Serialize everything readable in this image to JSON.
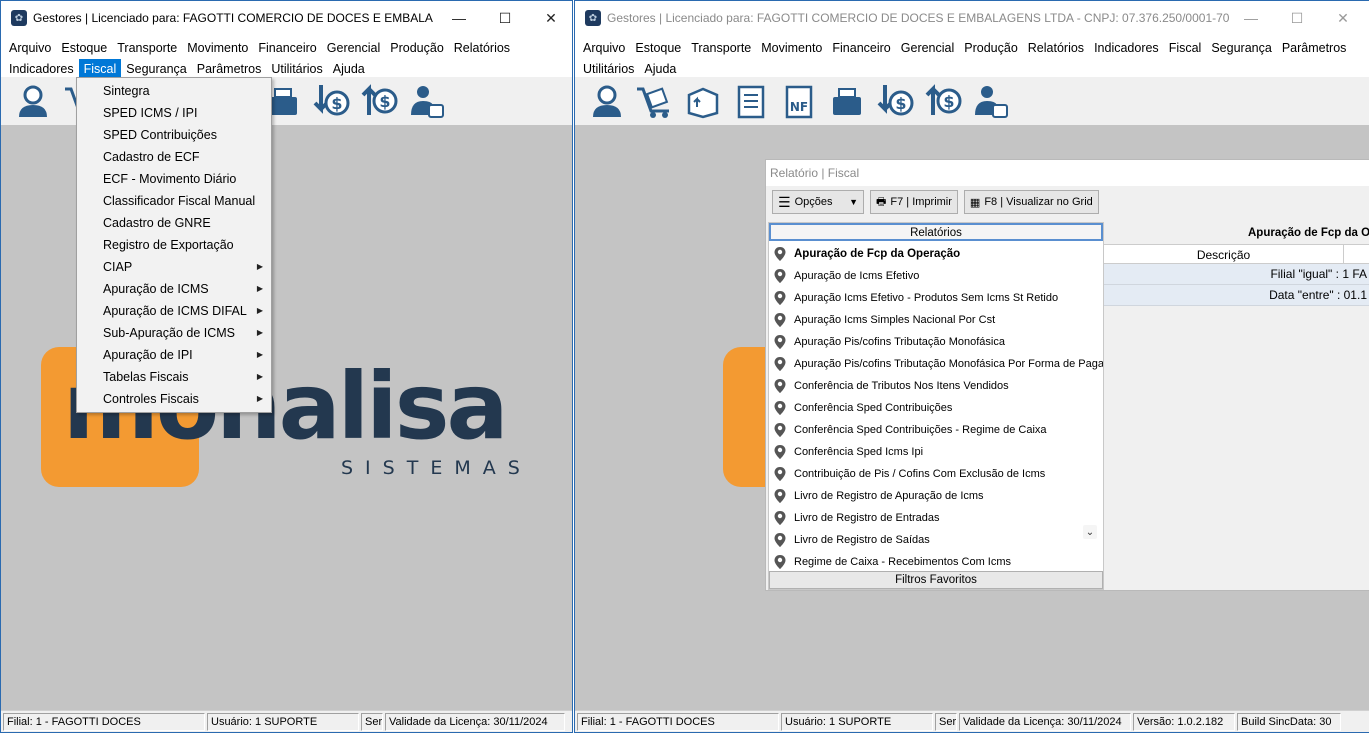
{
  "left_window": {
    "title": "Gestores | Licenciado para: FAGOTTI COMERCIO DE DOCES E EMBALAGEN...",
    "menu_row1": [
      "Arquivo",
      "Estoque",
      "Transporte",
      "Movimento",
      "Financeiro",
      "Gerencial",
      "Produção",
      "Relatórios"
    ],
    "menu_row2": [
      "Indicadores",
      "Fiscal",
      "Segurança",
      "Parâmetros",
      "Utilitários",
      "Ajuda"
    ],
    "active_menu": "Fiscal",
    "fiscal_menu": [
      {
        "label": "Sintegra",
        "submenu": false
      },
      {
        "label": "SPED ICMS / IPI",
        "submenu": false
      },
      {
        "label": "SPED Contribuições",
        "submenu": false
      },
      {
        "label": "Cadastro de ECF",
        "submenu": false
      },
      {
        "label": "ECF - Movimento Diário",
        "submenu": false
      },
      {
        "label": "Classificador Fiscal Manual",
        "submenu": false
      },
      {
        "label": "Cadastro de GNRE",
        "submenu": false
      },
      {
        "label": "Registro de Exportação",
        "submenu": false
      },
      {
        "label": "CIAP",
        "submenu": true
      },
      {
        "label": "Apuração de ICMS",
        "submenu": true
      },
      {
        "label": "Apuração de ICMS DIFAL",
        "submenu": true
      },
      {
        "label": "Sub-Apuração de ICMS",
        "submenu": true
      },
      {
        "label": "Apuração de IPI",
        "submenu": true
      },
      {
        "label": "Tabelas Fiscais",
        "submenu": true
      },
      {
        "label": "Controles Fiscais",
        "submenu": true
      }
    ],
    "logo": {
      "text": "monalisa",
      "sub": "SISTEMAS"
    },
    "status": {
      "filial": "Filial: 1 - FAGOTTI DOCES",
      "usuario": "Usuário: 1 SUPORTE",
      "ser": "Ser",
      "validade": "Validade da Licença: 30/11/2024"
    }
  },
  "right_window": {
    "title": "Gestores | Licenciado para: FAGOTTI COMERCIO DE DOCES E EMBALAGENS LTDA - CNPJ: 07.376.250/0001-70",
    "menu_row1": [
      "Arquivo",
      "Estoque",
      "Transporte",
      "Movimento",
      "Financeiro",
      "Gerencial",
      "Produção",
      "Relatórios",
      "Indicadores",
      "Fiscal",
      "Segurança",
      "Parâmetros"
    ],
    "menu_row2": [
      "Utilitários",
      "Ajuda"
    ],
    "status": {
      "filial": "Filial: 1 - FAGOTTI DOCES",
      "usuario": "Usuário: 1 SUPORTE",
      "ser": "Ser",
      "validade": "Validade da Licença: 30/11/2024",
      "versao": "Versão: 1.0.2.182",
      "build": "Build SincData: 30"
    }
  },
  "report": {
    "title": "Relatório | Fiscal",
    "opcoes_label": "Opções",
    "print_label": "F7 | Imprimir",
    "grid_label": "F8 | Visualizar no Grid",
    "relatorios_header": "Relatórios",
    "favoritos_label": "Filtros Favoritos",
    "items": [
      "Apuração de Fcp da Operação",
      "Apuração de Icms Efetivo",
      "Apuração Icms Efetivo - Produtos Sem Icms St Retido",
      "Apuração Icms Simples Nacional Por Cst",
      "Apuração Pis/cofins Tributação Monofásica",
      "Apuração Pis/cofins Tributação Monofásica Por Forma de Paga...",
      "Conferência de Tributos Nos Itens Vendidos",
      "Conferência Sped Contribuições",
      "Conferência Sped Contribuições - Regime de Caixa",
      "Conferência Sped Icms Ipi",
      "Contribuição de Pis / Cofins Com Exclusão de Icms",
      "Livro de Registro de Apuração de Icms",
      "Livro de Registro de Entradas",
      "Livro de Registro de Saídas",
      "Regime de Caixa - Recebimentos Com Icms"
    ],
    "selected_title": "Apuração de Fcp da O",
    "descricao_header": "Descrição",
    "filter_rows": [
      "Filial \"igual\" : 1 FA",
      "Data \"entre\" : 01.1"
    ]
  }
}
